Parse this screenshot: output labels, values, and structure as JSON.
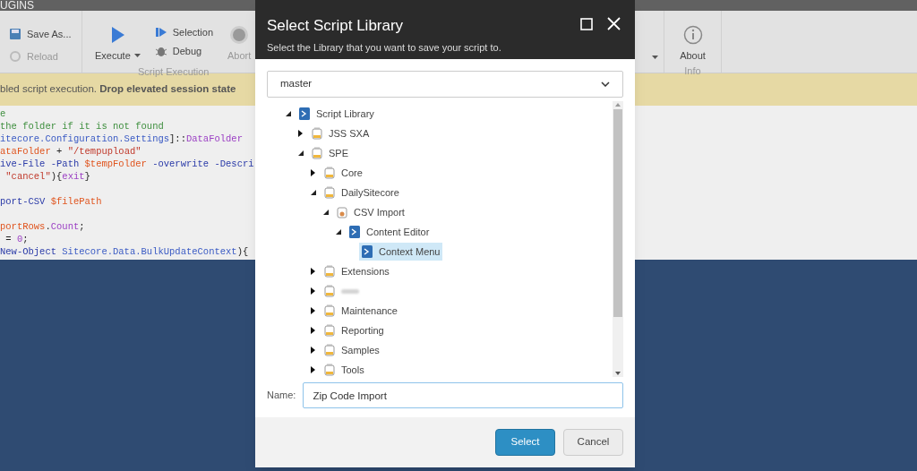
{
  "app_bar": {
    "title": "UGINS"
  },
  "ribbon": {
    "groups": [
      {
        "buttons": [
          {
            "label": "Save As...",
            "kind": "save",
            "disabled": false
          },
          {
            "label": "Reload",
            "kind": "reload",
            "disabled": true
          }
        ]
      },
      {
        "label": "Script Execution",
        "buttons": [
          {
            "label": "Execute",
            "kind": "execute",
            "disabled": false
          },
          {
            "label": "Selection",
            "kind": "selection",
            "disabled": false
          },
          {
            "label": "Debug",
            "kind": "debug",
            "disabled": false
          },
          {
            "label": "Abort",
            "kind": "abort",
            "disabled": true
          }
        ]
      },
      {
        "label": "Info",
        "buttons": [
          {
            "label": "About",
            "kind": "about",
            "disabled": false
          }
        ]
      }
    ]
  },
  "notice": {
    "text": "bled script execution. **Drop elevated session state**"
  },
  "code_lines": [
    {
      "tokens": [
        {
          "t": "e",
          "kind": "comment"
        }
      ]
    },
    {
      "tokens": [
        {
          "t": "the folder if it is not found",
          "kind": "comment"
        }
      ]
    },
    {
      "tokens": [
        {
          "t": "itecore.Configuration.Settings",
          "kind": "type"
        },
        {
          "t": "]::",
          "kind": "plain"
        },
        {
          "t": "DataFolder",
          "kind": "member"
        }
      ]
    },
    {
      "tokens": [
        {
          "t": "ataFolder",
          "kind": "var"
        },
        {
          "t": " + ",
          "kind": "plain"
        },
        {
          "t": "\"/tempupload\"",
          "kind": "string"
        }
      ]
    },
    {
      "tokens": [
        {
          "t": "ive-File",
          "kind": "cmd"
        },
        {
          "t": " -Path ",
          "kind": "cmd"
        },
        {
          "t": "$tempFolder",
          "kind": "var"
        },
        {
          "t": " -overwrite -Descri",
          "kind": "cmd"
        }
      ]
    },
    {
      "tokens": [
        {
          "t": " \"cancel\"",
          "kind": "string"
        },
        {
          "t": "){",
          "kind": "plain"
        },
        {
          "t": "exit",
          "kind": "member"
        },
        {
          "t": "}",
          "kind": "plain"
        }
      ]
    },
    {
      "blank_before": true,
      "tokens": [
        {
          "t": "port-CSV ",
          "kind": "cmd"
        },
        {
          "t": "$filePath",
          "kind": "var"
        }
      ]
    },
    {
      "blank_before": true,
      "tokens": [
        {
          "t": "portRows",
          "kind": "var"
        },
        {
          "t": ".",
          "kind": "plain"
        },
        {
          "t": "Count",
          "kind": "member"
        },
        {
          "t": ";",
          "kind": "plain"
        }
      ]
    },
    {
      "tokens": [
        {
          "t": " = ",
          "kind": "plain"
        },
        {
          "t": "0",
          "kind": "member"
        },
        {
          "t": ";",
          "kind": "plain"
        }
      ]
    },
    {
      "tokens": [
        {
          "t": "New-Object ",
          "kind": "cmd"
        },
        {
          "t": "Sitecore.Data.BulkUpdateContext",
          "kind": "type"
        },
        {
          "t": "){",
          "kind": "plain"
        }
      ]
    }
  ],
  "dialog": {
    "title": "Select Script Library",
    "subtitle": "Select the Library that you want to save your script to.",
    "database": "master",
    "tree": [
      {
        "label": "Script Library",
        "kind": "script",
        "expanded": true,
        "selected": false,
        "children": [
          {
            "label": "JSS SXA",
            "kind": "library",
            "expanded": false,
            "selected": false
          },
          {
            "label": "SPE",
            "kind": "library",
            "expanded": true,
            "selected": false,
            "children": [
              {
                "label": "Core",
                "kind": "library",
                "expanded": false,
                "selected": false
              },
              {
                "label": "DailySitecore",
                "kind": "library",
                "expanded": true,
                "selected": false,
                "children": [
                  {
                    "label": "CSV Import",
                    "kind": "module",
                    "expanded": true,
                    "selected": false,
                    "children": [
                      {
                        "label": "Content Editor",
                        "kind": "script",
                        "expanded": true,
                        "selected": false,
                        "children": [
                          {
                            "label": "Context Menu",
                            "kind": "script",
                            "selected": true
                          }
                        ]
                      }
                    ]
                  }
                ]
              },
              {
                "label": "Extensions",
                "kind": "library",
                "expanded": false,
                "selected": false
              },
              {
                "kind": "library",
                "expanded": false,
                "selected": false,
                "redacted": true
              },
              {
                "label": "Maintenance",
                "kind": "library",
                "expanded": false,
                "selected": false
              },
              {
                "label": "Reporting",
                "kind": "library",
                "expanded": false,
                "selected": false
              },
              {
                "label": "Samples",
                "kind": "library",
                "expanded": false,
                "selected": false
              },
              {
                "label": "Tools",
                "kind": "library",
                "expanded": false,
                "selected": false
              }
            ]
          }
        ]
      }
    ],
    "name_label": "Name:",
    "name_value": "Zip Code Import",
    "buttons": [
      {
        "label": "Select",
        "kind": "primary"
      },
      {
        "label": "Cancel",
        "kind": "secondary"
      }
    ]
  }
}
